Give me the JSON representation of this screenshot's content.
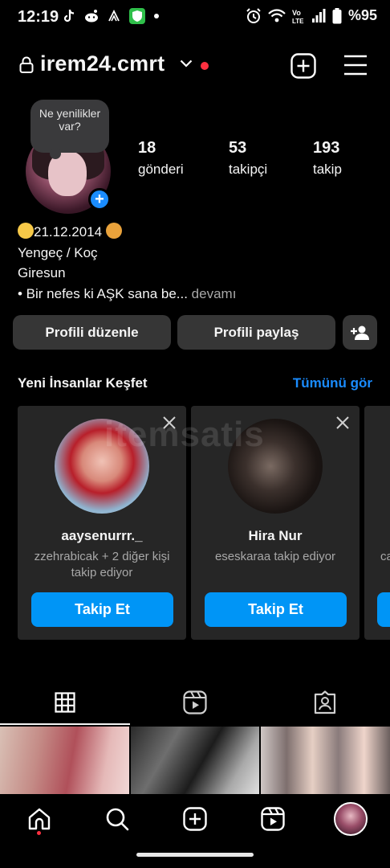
{
  "status_bar": {
    "time": "12:19",
    "battery_percent": "%95",
    "icons": [
      "tiktok-icon",
      "reddit-icon",
      "vpn-icon",
      "shield-icon",
      "alarm-icon",
      "wifi-icon",
      "volte-icon",
      "signal-icon",
      "battery-icon"
    ]
  },
  "header": {
    "username": "irem24.cmrt",
    "icons": [
      "lock-icon",
      "chevron-down-icon",
      "new-post-icon",
      "menu-icon"
    ]
  },
  "note": {
    "text": "Ne yenilikler var?"
  },
  "stats": [
    {
      "value": "18",
      "label": "gönderi"
    },
    {
      "value": "53",
      "label": "takipçi"
    },
    {
      "value": "193",
      "label": "takip"
    }
  ],
  "bio": {
    "line1": "21.12.2014",
    "line2": "Yengeç / Koç",
    "line3": "Giresun",
    "line4": "• Bir nefes ki AŞK sana be...",
    "more": " devamı"
  },
  "buttons": {
    "edit_profile": "Profili düzenle",
    "share_profile": "Profili paylaş"
  },
  "discover": {
    "title": "Yeni İnsanlar Keşfet",
    "see_all": "Tümünü gör",
    "cards": [
      {
        "name": "aaysenurrr._",
        "subtitle": "zzehrabicak + 2 diğer kişi takip ediyor",
        "follow_label": "Takip Et"
      },
      {
        "name": "Hira Nur",
        "subtitle": "eseskaraa takip ediyor",
        "follow_label": "Takip Et"
      },
      {
        "name": "",
        "subtitle": "ca",
        "follow_label": ""
      }
    ]
  },
  "watermark": "itemsatis",
  "colors": {
    "accent": "#0095f6",
    "link": "#1a8cff",
    "badge": "#ff3040",
    "button_bg": "#363636",
    "card_bg": "#262626"
  }
}
